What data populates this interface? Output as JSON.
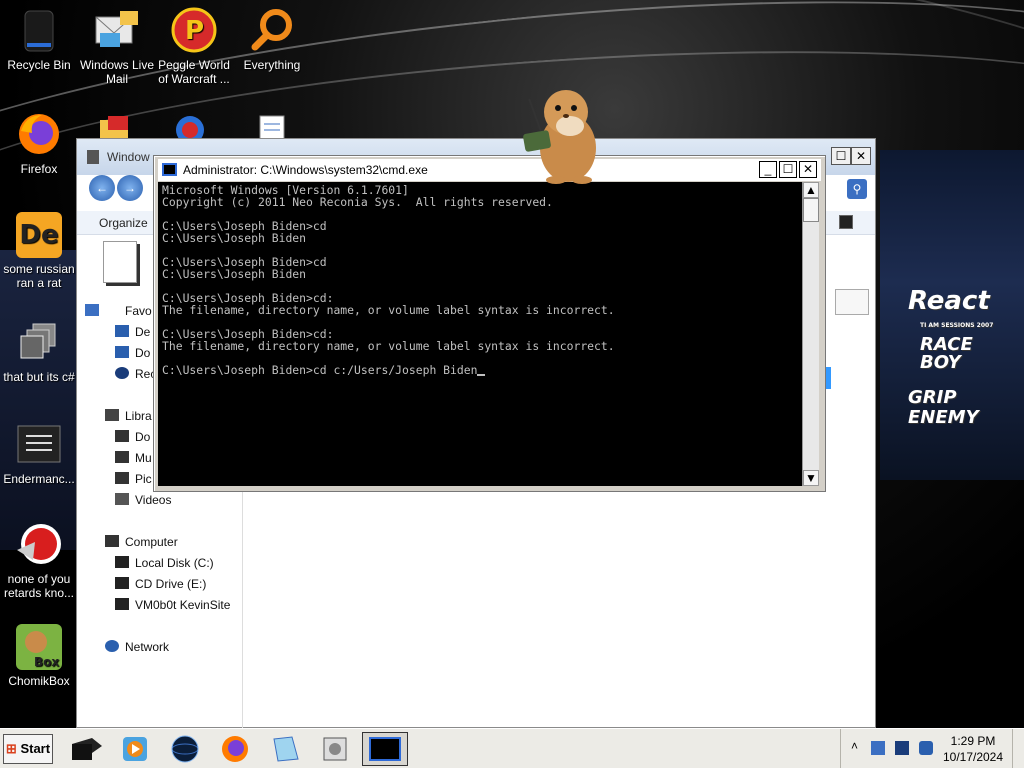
{
  "desktop": {
    "icons": [
      {
        "label": "Recycle Bin",
        "icon": "recycle-bin-icon"
      },
      {
        "label": "Windows Live Mail",
        "icon": "mail-icon"
      },
      {
        "label": "Peggle World of Warcraft ...",
        "icon": "peggle-icon"
      },
      {
        "label": "Everything",
        "icon": "search-magnifier-icon"
      },
      {
        "label": "Firefox",
        "icon": "firefox-icon"
      },
      {
        "label": "some russian ran a rat",
        "icon": "de-app-icon"
      },
      {
        "label": "that but its c#",
        "icon": "windows-stack-icon"
      },
      {
        "label": "Endermanc...",
        "icon": "terminal-list-icon"
      },
      {
        "label": "none of you retards kno...",
        "icon": "red-creature-icon"
      },
      {
        "label": "ChomikBox",
        "icon": "chomikbox-icon"
      }
    ],
    "wallpaper_logos": [
      "React",
      "RACE BOY",
      "GRIP ENEMY"
    ],
    "wallpaper_small_text": "TI AM SESSIONS 2007"
  },
  "explorer": {
    "title": "Window",
    "organize_label": "Organize",
    "nav_items": [
      {
        "label": "Favo",
        "icon": "star-icon"
      },
      {
        "label": "De",
        "icon": "desktop-icon"
      },
      {
        "label": "Do",
        "icon": "downloads-icon"
      },
      {
        "label": "Rec",
        "icon": "recent-icon"
      },
      {
        "label": "Libra",
        "icon": "library-icon"
      },
      {
        "label": "Do",
        "icon": "documents-icon"
      },
      {
        "label": "Mu",
        "icon": "music-icon"
      },
      {
        "label": "Pic",
        "icon": "pictures-icon"
      },
      {
        "label": "Videos",
        "icon": "videos-icon"
      },
      {
        "label": "Computer",
        "icon": "computer-icon"
      },
      {
        "label": "Local Disk (C:)",
        "icon": "drive-icon"
      },
      {
        "label": "CD Drive (E:)",
        "icon": "cd-drive-icon"
      },
      {
        "label": "VM0b0t KevinSite",
        "icon": "network-drive-icon"
      },
      {
        "label": "Network",
        "icon": "network-icon"
      }
    ]
  },
  "cmd": {
    "title": "Administrator: C:\\Windows\\system32\\cmd.exe",
    "lines": [
      "Microsoft Windows [Version 6.1.7601]",
      "Copyright (c) 2011 Neo Reconia Sys.  All rights reserved.",
      "",
      "C:\\Users\\Joseph Biden>cd",
      "C:\\Users\\Joseph Biden",
      "",
      "C:\\Users\\Joseph Biden>cd",
      "C:\\Users\\Joseph Biden",
      "",
      "C:\\Users\\Joseph Biden>cd:",
      "The filename, directory name, or volume label syntax is incorrect.",
      "",
      "C:\\Users\\Joseph Biden>cd:",
      "The filename, directory name, or volume label syntax is incorrect.",
      ""
    ],
    "current_input": "C:\\Users\\Joseph Biden>cd c:/Users/Joseph Biden"
  },
  "taskbar": {
    "start_label": "Start",
    "apps": [
      "terminal-app-icon",
      "media-player-icon",
      "globe-icon",
      "firefox-icon",
      "notes-icon",
      "disk-utility-icon",
      "cmd-icon"
    ],
    "time": "1:29 PM",
    "date": "10/17/2024"
  },
  "colors": {
    "console_bg": "#000000",
    "console_text": "#c0c0c0",
    "taskbar_bg": "#ecebe6"
  }
}
